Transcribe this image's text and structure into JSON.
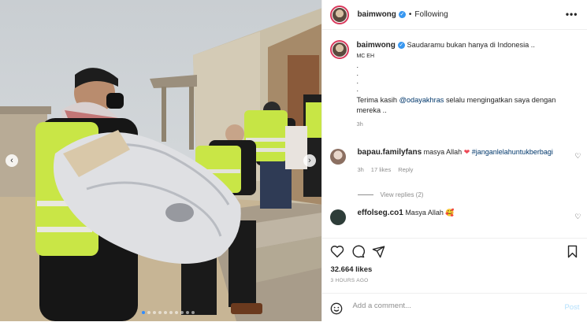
{
  "post": {
    "username": "baimwong",
    "follow_status": "Following",
    "separator": "•",
    "more_label": "•••",
    "caption": {
      "text": "Saudaramu bukan hanya di Indonesia ..",
      "subline": "MC EH",
      "dots": [
        ".",
        ".",
        ".",
        "."
      ],
      "thanks_before": "Terima kasih ",
      "thanks_mention": "@odayakhras",
      "thanks_after": " selalu mengingatkan saya dengan mereka ..",
      "time": "3h"
    },
    "comments": [
      {
        "username": "bapau.familyfans",
        "text_before": " masya Allah ",
        "hashtag": "#janganlelahuntukberbagi",
        "time": "3h",
        "likes": "17 likes",
        "reply": "Reply"
      },
      {
        "username": "effolseg.co1",
        "text_before": " Masya Allah ",
        "emoji": "🥰"
      }
    ],
    "view_replies": "View replies (2)",
    "likes": "32.664 likes",
    "posted_ago": "3 HOURS AGO",
    "add_comment_placeholder": "Add a comment...",
    "post_button": "Post",
    "carousel": {
      "prev": "‹",
      "next": "›",
      "total": 10,
      "active": 0
    },
    "icons": [
      "heart-icon",
      "comment-icon",
      "share-icon",
      "bookmark-icon",
      "emoji-icon",
      "verified-badge-icon",
      "more-options-icon"
    ],
    "colors": {
      "accent": "#3897f0",
      "link": "#00376b",
      "muted": "#8e8e8e",
      "heart_red": "#ed4956",
      "story_ring": "#d8385b"
    }
  }
}
